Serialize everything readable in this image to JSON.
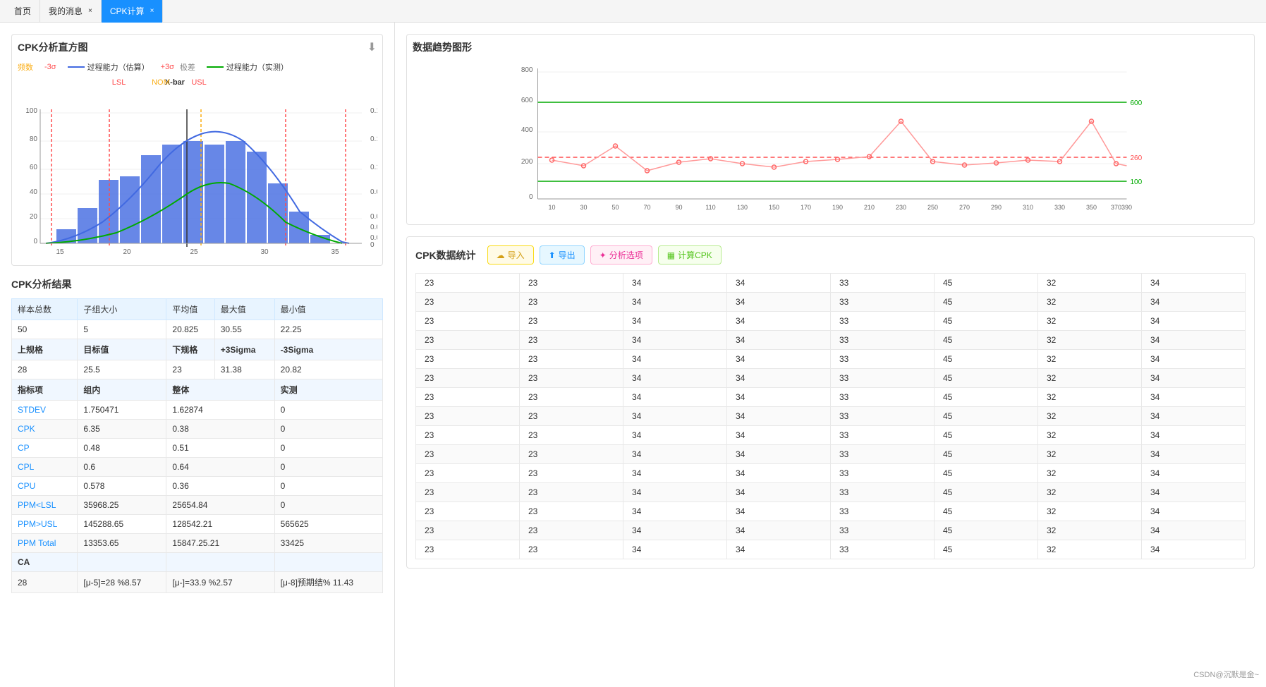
{
  "tabs": [
    {
      "label": "首页",
      "active": false,
      "closable": false
    },
    {
      "label": "我的消息",
      "active": false,
      "closable": true
    },
    {
      "label": "CPK计算",
      "active": true,
      "closable": true
    }
  ],
  "left": {
    "histogram_title": "CPK分析直方图",
    "legend": [
      {
        "label": "频数",
        "color": "#4169E1",
        "type": "dot"
      },
      {
        "label": "-3σ",
        "color": "#ff4d4f"
      },
      {
        "label": "过程能力（估算）",
        "color": "#4169E1",
        "type": "line"
      },
      {
        "label": "+3σ",
        "color": "#ff4d4f"
      },
      {
        "label": "极差",
        "color": "#333"
      },
      {
        "label": "过程能力（实测）",
        "color": "#00aa00",
        "type": "line"
      }
    ],
    "chart_labels": {
      "xbar": "X-bar",
      "lsl": "LSL",
      "nom": "NOM",
      "usl": "USL"
    },
    "analysis_title": "CPK分析结果",
    "table_headers_row1": [
      "样本总数",
      "子组大小",
      "平均值",
      "最大值",
      "最小值"
    ],
    "table_row1": [
      "50",
      "5",
      "20.825",
      "30.55",
      "22.25"
    ],
    "table_headers_row2": [
      "上规格",
      "目标值",
      "下规格",
      "+3Sigma",
      "-3Sigma"
    ],
    "table_row2": [
      "28",
      "25.5",
      "23",
      "31.38",
      "20.82"
    ],
    "metrics": [
      {
        "name": "指标项",
        "group": "组内",
        "overall": "整体",
        "measured": "实测",
        "is_header": true
      },
      {
        "name": "STDEV",
        "group": "1.750471",
        "overall": "1.62874",
        "measured": "0"
      },
      {
        "name": "CPK",
        "group": "6.35",
        "overall": "0.38",
        "measured": "0"
      },
      {
        "name": "CP",
        "group": "0.48",
        "overall": "0.51",
        "measured": "0"
      },
      {
        "name": "CPL",
        "group": "0.6",
        "overall": "0.64",
        "measured": "0"
      },
      {
        "name": "CPU",
        "group": "0.578",
        "overall": "0.36",
        "measured": "0"
      },
      {
        "name": "PPM<LSL",
        "group": "35968.25",
        "overall": "25654.84",
        "measured": "0"
      },
      {
        "name": "PPM>USL",
        "group": "145288.65",
        "overall": "128542.21",
        "measured": "565625"
      },
      {
        "name": "PPM Total",
        "group": "13353.65",
        "overall": "15847.25.21",
        "measured": "33425"
      },
      {
        "name": "CA",
        "group": "",
        "overall": "",
        "measured": ""
      }
    ],
    "last_row": [
      "28",
      "[μ-5]=28 %8.57",
      "[μ-]=33.9 %2.57",
      "[μ-8]预期结% 11.43"
    ]
  },
  "right": {
    "trend_title": "数据趋势图形",
    "trend_chart": {
      "y_max": 800,
      "y_labels": [
        800,
        600,
        400,
        200,
        0
      ],
      "x_labels": [
        10,
        30,
        50,
        70,
        90,
        110,
        130,
        150,
        170,
        190,
        210,
        230,
        250,
        270,
        290,
        310,
        330,
        350,
        370,
        390
      ],
      "lines": [
        {
          "value": 600,
          "color": "#00aa00"
        },
        {
          "value": 260,
          "color": "#ff4d4f",
          "dashed": true
        },
        {
          "value": 100,
          "color": "#00aa00"
        }
      ]
    },
    "data_section_title": "CPK数据统计",
    "buttons": [
      {
        "label": "导入",
        "icon": "☁",
        "class": "btn-import"
      },
      {
        "label": "导出",
        "icon": "↑",
        "class": "btn-export"
      },
      {
        "label": "分析选项",
        "icon": "✦",
        "class": "btn-analysis"
      },
      {
        "label": "计算CPK",
        "icon": "▦",
        "class": "btn-calculate"
      }
    ],
    "data_rows": [
      [
        23,
        23,
        34,
        34,
        33,
        45,
        32,
        34
      ],
      [
        23,
        23,
        34,
        34,
        33,
        45,
        32,
        34
      ],
      [
        23,
        23,
        34,
        34,
        33,
        45,
        32,
        34
      ],
      [
        23,
        23,
        34,
        34,
        33,
        45,
        32,
        34
      ],
      [
        23,
        23,
        34,
        34,
        33,
        45,
        32,
        34
      ],
      [
        23,
        23,
        34,
        34,
        33,
        45,
        32,
        34
      ],
      [
        23,
        23,
        34,
        34,
        33,
        45,
        32,
        34
      ],
      [
        23,
        23,
        34,
        34,
        33,
        45,
        32,
        34
      ],
      [
        23,
        23,
        34,
        34,
        33,
        45,
        32,
        34
      ],
      [
        23,
        23,
        34,
        34,
        33,
        45,
        32,
        34
      ],
      [
        23,
        23,
        34,
        34,
        33,
        45,
        32,
        34
      ],
      [
        23,
        23,
        34,
        34,
        33,
        45,
        32,
        34
      ],
      [
        23,
        23,
        34,
        34,
        33,
        45,
        32,
        34
      ],
      [
        23,
        23,
        34,
        34,
        33,
        45,
        32,
        34
      ],
      [
        23,
        23,
        34,
        34,
        33,
        45,
        32,
        34
      ]
    ]
  },
  "watermark": "CSDN@沉默是金~"
}
